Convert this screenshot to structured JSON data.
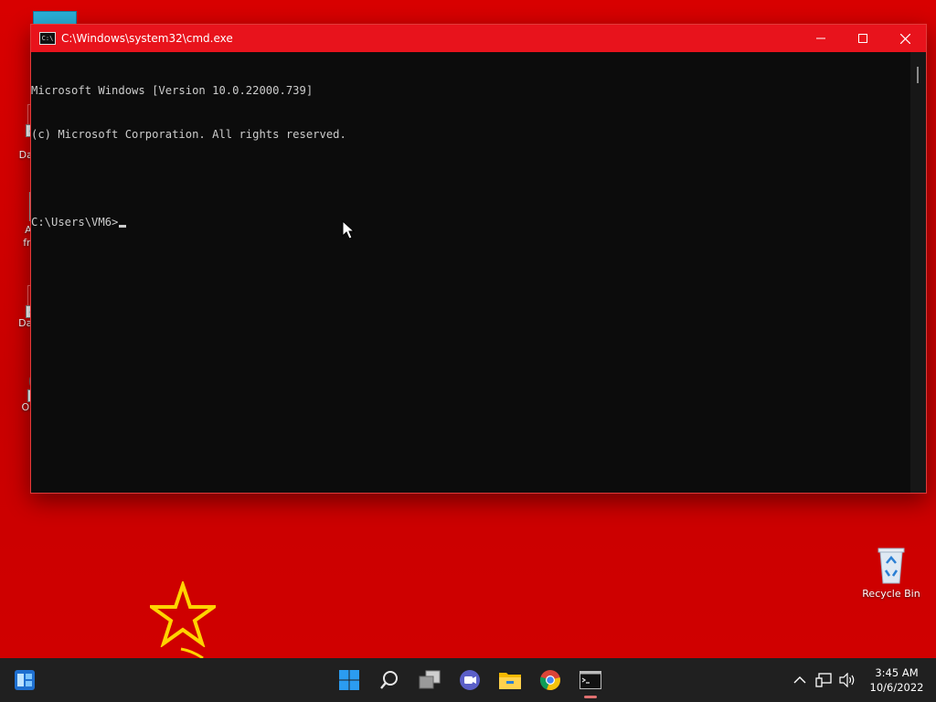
{
  "desktop": {
    "icons": [
      {
        "label": "Con",
        "top": "C"
      },
      {
        "label": "Datav",
        "top": "C"
      },
      {
        "label": "A m",
        "sub": "from"
      },
      {
        "label": "DataV"
      },
      {
        "label": "OBS"
      }
    ],
    "recycle_bin": "Recycle Bin"
  },
  "window": {
    "title": "C:\\Windows\\system32\\cmd.exe",
    "icon_text": "C:\\",
    "console_lines": [
      "Microsoft Windows [Version 10.0.22000.739]",
      "(c) Microsoft Corporation. All rights reserved.",
      "",
      "C:\\Users\\VM6>"
    ]
  },
  "taskbar": {
    "items": [
      "start-icon",
      "search-icon",
      "task-view-icon",
      "chat-icon",
      "file-explorer-icon",
      "chrome-icon",
      "terminal-icon"
    ],
    "active": "terminal-icon"
  },
  "tray": {
    "time": "3:45 AM",
    "date": "10/6/2022"
  },
  "colors": {
    "desktop": "#d30000",
    "titlebar": "#e8131c",
    "console_bg": "#0c0c0c",
    "console_fg": "#cccccc",
    "taskbar": "#202020"
  }
}
